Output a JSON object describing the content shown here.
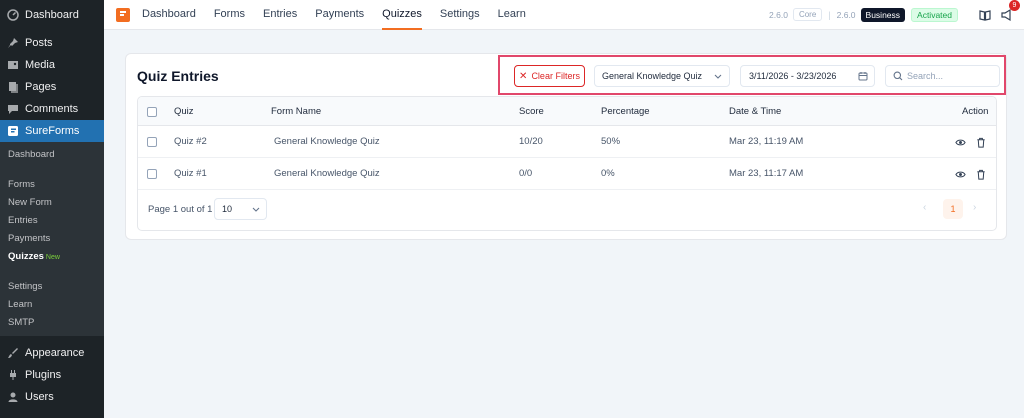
{
  "sidebar": {
    "dashboard": "Dashboard",
    "posts": "Posts",
    "media": "Media",
    "pages": "Pages",
    "comments": "Comments",
    "sureforms": "SureForms",
    "sub": {
      "dashboard": "Dashboard",
      "forms": "Forms",
      "new_form": "New Form",
      "entries": "Entries",
      "payments": "Payments",
      "quizzes": "Quizzes",
      "quizzes_badge": "New",
      "settings": "Settings",
      "learn": "Learn",
      "smtp": "SMTP"
    },
    "appearance": "Appearance",
    "plugins": "Plugins",
    "users": "Users"
  },
  "topnav": {
    "items": [
      "Dashboard",
      "Forms",
      "Entries",
      "Payments",
      "Quizzes",
      "Settings",
      "Learn"
    ],
    "active": "Quizzes",
    "core_version": "2.6.0",
    "core_label": "Core",
    "business_version": "2.6.0",
    "business_label": "Business",
    "status": "Activated",
    "notification_count": "9"
  },
  "page": {
    "title": "Quiz Entries"
  },
  "filters": {
    "clear_label": "Clear Filters",
    "form_select": "General Knowledge Quiz",
    "date_range": "3/11/2026 - 3/23/2026",
    "search_placeholder": "Search..."
  },
  "table": {
    "headers": {
      "quiz": "Quiz",
      "form_name": "Form Name",
      "score": "Score",
      "percentage": "Percentage",
      "date_time": "Date & Time",
      "action": "Action"
    },
    "rows": [
      {
        "quiz": "Quiz #2",
        "form_name": "General Knowledge Quiz",
        "score": "10/20",
        "percentage": "50%",
        "date_time": "Mar 23, 11:19 AM"
      },
      {
        "quiz": "Quiz #1",
        "form_name": "General Knowledge Quiz",
        "score": "0/0",
        "percentage": "0%",
        "date_time": "Mar 23, 11:17 AM"
      }
    ]
  },
  "pagination": {
    "info": "Page 1 out of 1",
    "per_page": "10",
    "current": "1"
  },
  "colors": {
    "accent": "#f26d21",
    "wp_blue": "#2271b1",
    "sidebar_bg": "#1d2327",
    "highlight_border": "#e1476b",
    "danger": "#dc2626"
  }
}
